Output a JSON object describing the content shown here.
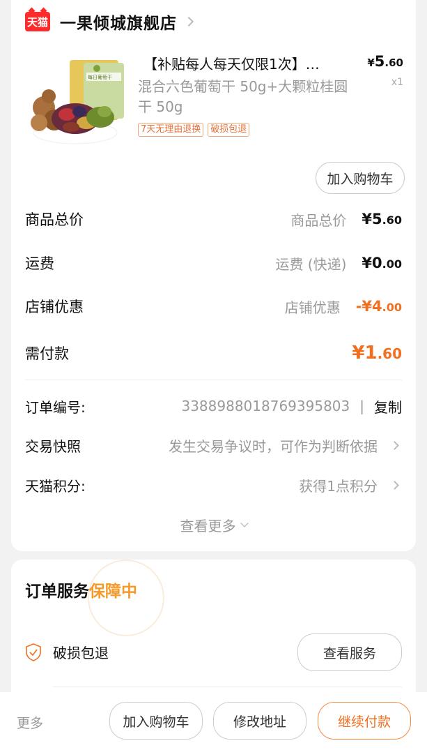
{
  "store": {
    "badge": "天猫",
    "name": "一果倾城旗舰店"
  },
  "product": {
    "title": "【补贴每人每天仅限1次】…",
    "subtitle": "混合六色葡萄干 50g+大颗粒桂圆干 50g",
    "tags": [
      "7天无理由退换",
      "破损包退"
    ],
    "price_currency": "¥",
    "price_int": "5",
    "price_dec": ".60",
    "qty": "x1",
    "add_cart_label": "加入购物车",
    "package_label": "每日葡萄干"
  },
  "summary": {
    "total_label": "商品总价",
    "total_sub": "商品总价",
    "total_int": "¥5",
    "total_dec": ".60",
    "shipping_label": "运费",
    "shipping_sub": "运费 (快递)",
    "shipping_int": "¥0",
    "shipping_dec": ".00",
    "discount_label": "店铺优惠",
    "discount_sub": "店铺优惠",
    "discount_int": "-¥4",
    "discount_dec": ".00",
    "pay_label": "需付款",
    "pay_int": "¥1",
    "pay_dec": ".60"
  },
  "info": {
    "order_no_label": "订单编号:",
    "order_no": "3388988018769395803",
    "separator": "|",
    "copy_label": "复制",
    "snapshot_label": "交易快照",
    "snapshot_value": "发生交易争议时，可作为判断依据",
    "points_label": "天猫积分:",
    "points_value": "获得1点积分",
    "more_label": "查看更多"
  },
  "service": {
    "title": "订单服务",
    "status": "保障中",
    "item_label": "破损包退",
    "view_button": "查看服务"
  },
  "bottom_bar": {
    "more": "更多",
    "add_cart": "加入购物车",
    "edit_address": "修改地址",
    "continue_pay": "继续付款"
  },
  "colors": {
    "accent": "#f07020",
    "tmall_red": "#ff2a2a",
    "guarantee": "#f59a2a"
  }
}
